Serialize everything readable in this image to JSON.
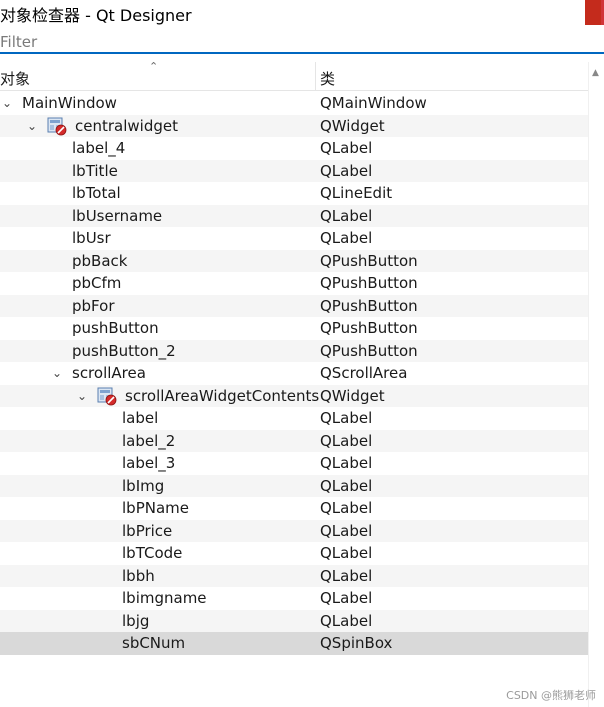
{
  "window": {
    "title": "对象检查器 - Qt Designer"
  },
  "filter": {
    "placeholder": "Filter",
    "value": ""
  },
  "header": {
    "object_col": "对象",
    "class_col": "类",
    "sort_indicator": "⌃"
  },
  "tree": [
    {
      "name": "MainWindow",
      "cls": "QMainWindow",
      "depth": 0,
      "expanded": true,
      "icon": "none"
    },
    {
      "name": "centralwidget",
      "cls": "QWidget",
      "depth": 1,
      "expanded": true,
      "icon": "layout-broken-icon"
    },
    {
      "name": "label_4",
      "cls": "QLabel",
      "depth": 2
    },
    {
      "name": "lbTitle",
      "cls": "QLabel",
      "depth": 2
    },
    {
      "name": "lbTotal",
      "cls": "QLineEdit",
      "depth": 2
    },
    {
      "name": "lbUsername",
      "cls": "QLabel",
      "depth": 2
    },
    {
      "name": "lbUsr",
      "cls": "QLabel",
      "depth": 2
    },
    {
      "name": "pbBack",
      "cls": "QPushButton",
      "depth": 2
    },
    {
      "name": "pbCfm",
      "cls": "QPushButton",
      "depth": 2
    },
    {
      "name": "pbFor",
      "cls": "QPushButton",
      "depth": 2
    },
    {
      "name": "pushButton",
      "cls": "QPushButton",
      "depth": 2
    },
    {
      "name": "pushButton_2",
      "cls": "QPushButton",
      "depth": 2
    },
    {
      "name": "scrollArea",
      "cls": "QScrollArea",
      "depth": 2,
      "expanded": true,
      "icon": "none"
    },
    {
      "name": "scrollAreaWidgetContents",
      "cls": "QWidget",
      "depth": 3,
      "expanded": true,
      "icon": "layout-broken-icon"
    },
    {
      "name": "label",
      "cls": "QLabel",
      "depth": 4
    },
    {
      "name": "label_2",
      "cls": "QLabel",
      "depth": 4
    },
    {
      "name": "label_3",
      "cls": "QLabel",
      "depth": 4
    },
    {
      "name": "lbImg",
      "cls": "QLabel",
      "depth": 4
    },
    {
      "name": "lbPName",
      "cls": "QLabel",
      "depth": 4
    },
    {
      "name": "lbPrice",
      "cls": "QLabel",
      "depth": 4
    },
    {
      "name": "lbTCode",
      "cls": "QLabel",
      "depth": 4
    },
    {
      "name": "lbbh",
      "cls": "QLabel",
      "depth": 4
    },
    {
      "name": "lbimgname",
      "cls": "QLabel",
      "depth": 4
    },
    {
      "name": "lbjg",
      "cls": "QLabel",
      "depth": 4
    },
    {
      "name": "sbCNum",
      "cls": "QSpinBox",
      "depth": 4,
      "selected": true
    }
  ],
  "colors": {
    "alt_row": "#f5f5f5",
    "selected_row": "#d9d9d9",
    "filter_underline": "#0067c0",
    "close_red": "#c42b1c"
  },
  "watermark": "CSDN @熊狮老师"
}
